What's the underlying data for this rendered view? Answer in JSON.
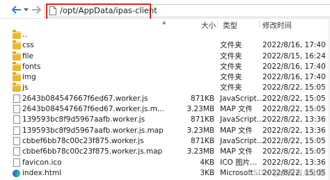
{
  "address": {
    "path": "/opt/AppData/ipas-client"
  },
  "columns": {
    "name": "",
    "size": "大小",
    "type": "类型",
    "modified": "修改时间"
  },
  "files": [
    {
      "name": "..",
      "size": "",
      "type": "",
      "modified": "",
      "icon": "folder-icon"
    },
    {
      "name": "css",
      "size": "",
      "type": "文件夹",
      "modified": "2022/8/16, 17:40",
      "icon": "folder-icon"
    },
    {
      "name": "file",
      "size": "",
      "type": "文件夹",
      "modified": "2022/8/15, 16:24",
      "icon": "folder-icon"
    },
    {
      "name": "fonts",
      "size": "",
      "type": "文件夹",
      "modified": "2022/8/16, 17:40",
      "icon": "folder-icon"
    },
    {
      "name": "img",
      "size": "",
      "type": "文件夹",
      "modified": "2022/8/16, 17:40",
      "icon": "folder-icon"
    },
    {
      "name": "js",
      "size": "",
      "type": "文件夹",
      "modified": "2022/8/22, 15:05",
      "icon": "folder-icon"
    },
    {
      "name": "2643b084547667f6ed67.worker.js",
      "size": "871KB",
      "type": "JavaScript...",
      "modified": "2022/8/22, 15:05",
      "icon": "file-icon"
    },
    {
      "name": "2643b084547667f6ed67.worker.js.m...",
      "size": "3.23MB",
      "type": "MAP 文件",
      "modified": "2022/8/22, 15:05",
      "icon": "file-icon"
    },
    {
      "name": "139593bc8f9d5967aafb.worker.js",
      "size": "871KB",
      "type": "JavaScript...",
      "modified": "2022/8/22, 13:36",
      "icon": "file-icon"
    },
    {
      "name": "139593bc8f9d5967aafb.worker.js.map",
      "size": "3.23MB",
      "type": "MAP 文件",
      "modified": "2022/8/22, 13:36",
      "icon": "file-icon"
    },
    {
      "name": "cbbef6bb78c00c23f875.worker.js",
      "size": "871KB",
      "type": "JavaScript...",
      "modified": "2022/8/22, 15:05",
      "icon": "file-icon"
    },
    {
      "name": "cbbef6bb78c00c23f875.worker.js.map",
      "size": "3.23MB",
      "type": "MAP 文件",
      "modified": "2022/8/22, 15:05",
      "icon": "file-icon"
    },
    {
      "name": "favicon.ico",
      "size": "4KB",
      "type": "ICO 图片...",
      "modified": "2022/8/22, 13:36",
      "icon": "file-icon"
    },
    {
      "name": "index.html",
      "size": "3KB",
      "type": "Microsoft...",
      "modified": "2022/8/22, 15:05",
      "icon": "edge-icon"
    }
  ],
  "watermark": "CSDN @小蔚有点小蘑",
  "colors": {
    "highlight": "#e2231a",
    "nav_arrow": "#2f7de1",
    "folder": "#e8b830"
  }
}
